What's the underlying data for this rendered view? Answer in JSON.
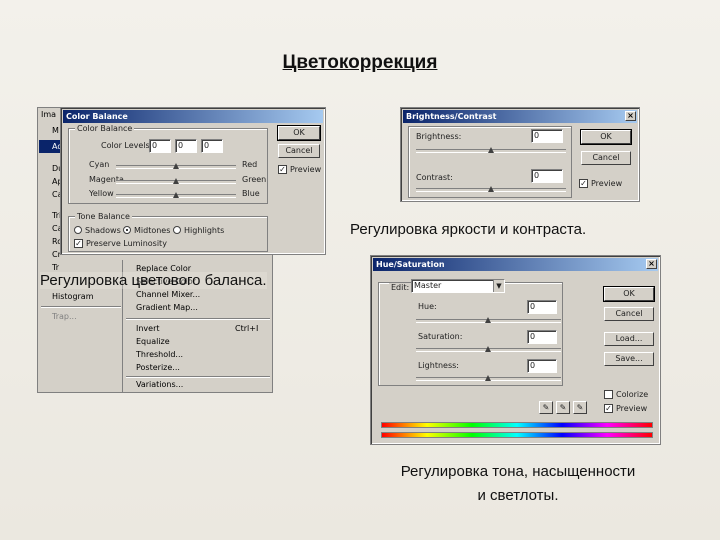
{
  "title": "Цветокоррекция",
  "captions": {
    "brightness": "Регулировка яркости и контраста.",
    "color_balance": "Регулировка цветового баланса.",
    "hue_sat_1": "Регулировка тона, насыщенности",
    "hue_sat_2": "и светлоты."
  },
  "menu": {
    "top_labels": [
      "Ima",
      "M",
      "Ad",
      "Du",
      "Ap",
      "Ca",
      "Tri",
      "Ca",
      "Ro",
      "Cr",
      "Tr",
      "Histogram",
      "Trap..."
    ],
    "sub_items": [
      "Replace Color",
      "Selective Color",
      "Channel Mixer...",
      "Gradient Map...",
      "Invert",
      "Equalize",
      "Threshold...",
      "Posterize...",
      "Variations..."
    ],
    "invert_shortcut": "Ctrl+I"
  },
  "color_balance": {
    "title": "Color Balance",
    "group_cb": "Color Balance",
    "color_levels_label": "Color Levels:",
    "levels": [
      "0",
      "0",
      "0"
    ],
    "left": [
      "Cyan",
      "Magenta",
      "Yellow"
    ],
    "right": [
      "Red",
      "Green",
      "Blue"
    ],
    "group_tone": "Tone Balance",
    "tones": [
      "Shadows",
      "Midtones",
      "Highlights"
    ],
    "preserve": "Preserve Luminosity",
    "ok": "OK",
    "cancel": "Cancel",
    "preview": "Preview"
  },
  "brightness": {
    "title": "Brightness/Contrast",
    "bright_label": "Brightness:",
    "bright_val": "0",
    "contrast_label": "Contrast:",
    "contrast_val": "0",
    "ok": "OK",
    "cancel": "Cancel",
    "preview": "Preview"
  },
  "hue_sat": {
    "title": "Hue/Saturation",
    "edit_label": "Edit:",
    "edit_value": "Master",
    "hue_label": "Hue:",
    "hue_val": "0",
    "sat_label": "Saturation:",
    "sat_val": "0",
    "light_label": "Lightness:",
    "light_val": "0",
    "ok": "OK",
    "cancel": "Cancel",
    "load": "Load...",
    "save": "Save...",
    "colorize": "Colorize",
    "preview": "Preview",
    "spectrum": "spectrum-bar"
  }
}
